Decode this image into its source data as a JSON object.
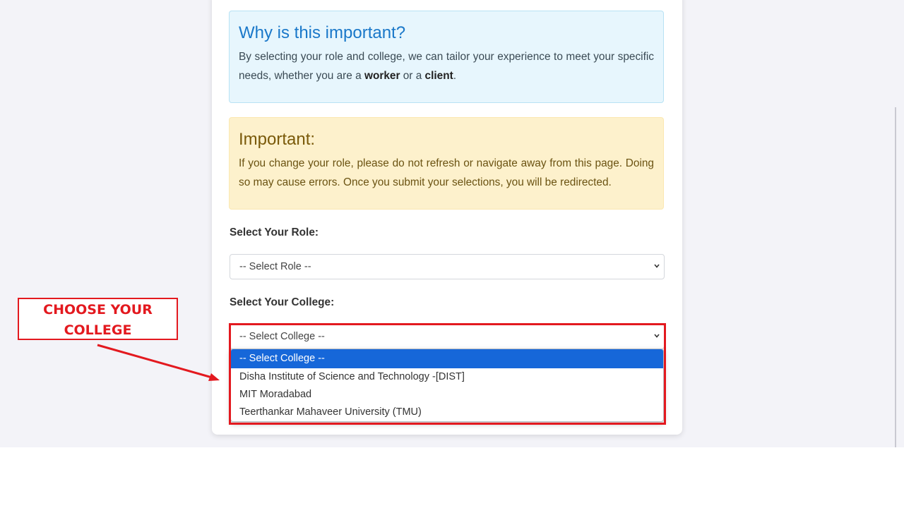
{
  "info_alert": {
    "title": "Why is this important?",
    "body_prefix": "By selecting your role and college, we can tailor your experience to meet your specific needs, whether you are a ",
    "worker": "worker",
    "or_a": " or a ",
    "client": "client",
    "period": "."
  },
  "warning_alert": {
    "title": "Important:",
    "body": "If you change your role, please do not refresh or navigate away from this page. Doing so may cause errors. Once you submit your selections, you will be redirected."
  },
  "role": {
    "label": "Select Your Role:",
    "value": "-- Select Role --"
  },
  "college": {
    "label": "Select Your College:",
    "value": "-- Select College --",
    "options": [
      "-- Select College --",
      "Disha Institute of Science and Technology -[DIST]",
      "MIT Moradabad",
      "Teerthankar Mahaveer University (TMU)"
    ]
  },
  "annotation": {
    "line1": "CHOOSE YOUR",
    "line2": "COLLEGE",
    "color": "#e3191f"
  },
  "colors": {
    "selected_option": "#1667d9",
    "info_title": "#1a78c9",
    "warning_background": "#fdf1cc"
  }
}
